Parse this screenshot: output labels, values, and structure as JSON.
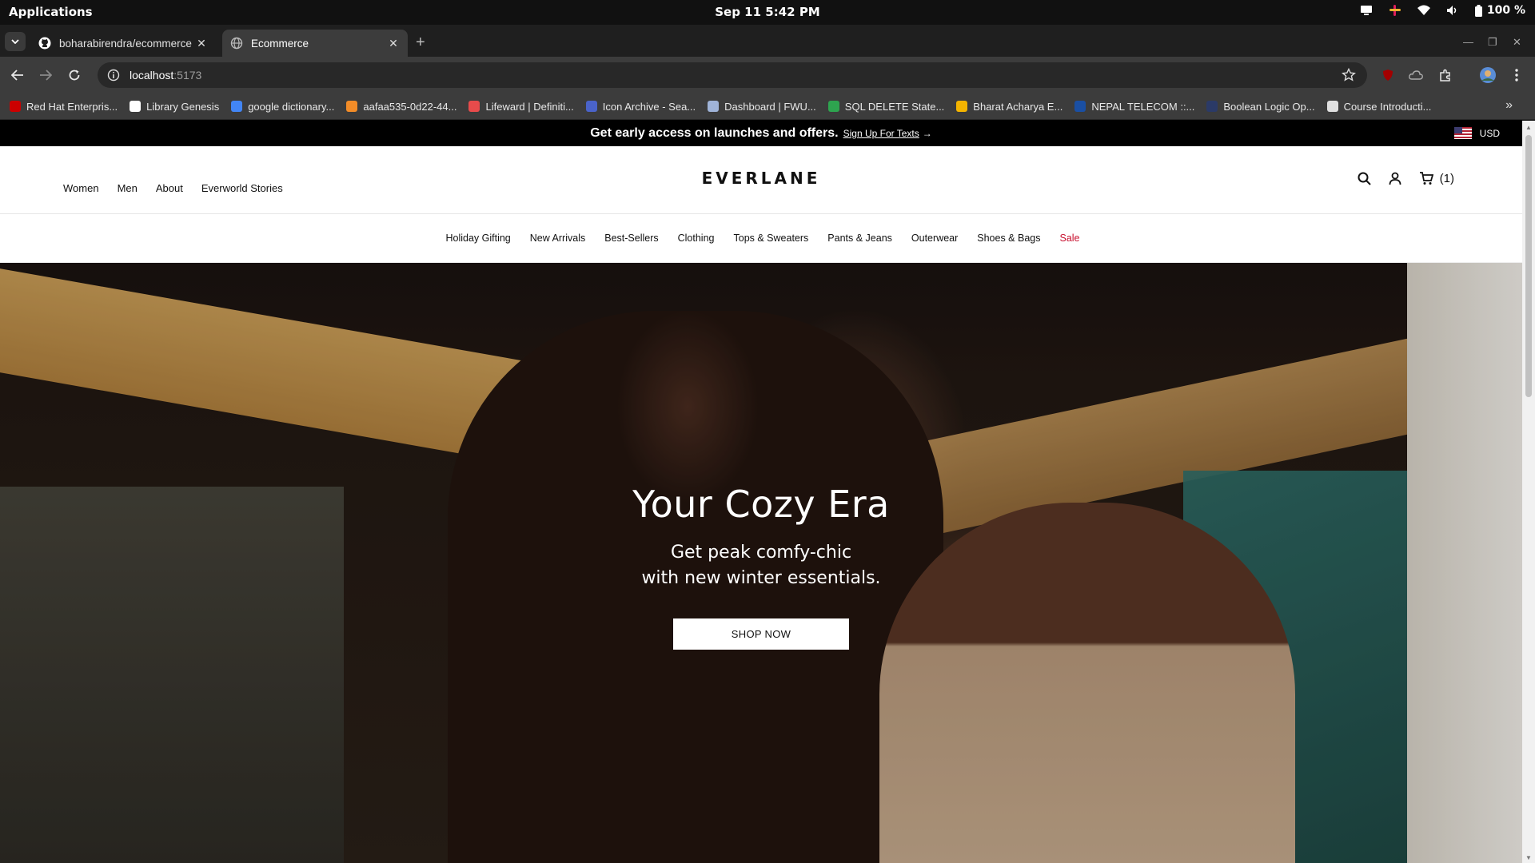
{
  "os": {
    "apps_label": "Applications",
    "clock": "Sep 11  5:42 PM",
    "battery": "100 %"
  },
  "browser": {
    "tabs": [
      {
        "title": "boharabirendra/ecommerce",
        "icon": "github-icon"
      },
      {
        "title": "Ecommerce",
        "icon": "globe-icon"
      }
    ],
    "url_host": "localhost",
    "url_port": ":5173",
    "bookmarks": [
      {
        "label": "Red Hat Enterpris...",
        "color": "#cc0000"
      },
      {
        "label": "Library Genesis",
        "color": "#ffffff"
      },
      {
        "label": "google dictionary...",
        "color": "#4285f4"
      },
      {
        "label": "aafaa535-0d22-44...",
        "color": "#f28c28"
      },
      {
        "label": "Lifeward | Definiti...",
        "color": "#e84b4b"
      },
      {
        "label": "Icon Archive - Sea...",
        "color": "#4a63c9"
      },
      {
        "label": "Dashboard | FWU...",
        "color": "#9fb3d8"
      },
      {
        "label": "SQL DELETE State...",
        "color": "#2ea44f"
      },
      {
        "label": "Bharat Acharya E...",
        "color": "#f4b400"
      },
      {
        "label": "NEPAL TELECOM ::...",
        "color": "#1a4fa3"
      },
      {
        "label": "Boolean Logic Op...",
        "color": "#2b3a67"
      },
      {
        "label": "Course Introducti...",
        "color": "#e0e0e0"
      }
    ],
    "bookmarks_more": "»"
  },
  "page": {
    "promo": {
      "text": "Get early access on launches and offers.",
      "link": "Sign Up For Texts",
      "arrow": "→",
      "currency": "USD"
    },
    "header": {
      "nav": [
        "Women",
        "Men",
        "About",
        "Everworld Stories"
      ],
      "logo": "EVERLANE",
      "cart_count": "(1)"
    },
    "categories": [
      "Holiday Gifting",
      "New Arrivals",
      "Best-Sellers",
      "Clothing",
      "Tops & Sweaters",
      "Pants & Jeans",
      "Outerwear",
      "Shoes & Bags"
    ],
    "sale_label": "Sale",
    "hero": {
      "title": "Your Cozy Era",
      "subtitle_line1": "Get peak comfy-chic",
      "subtitle_line2": "with new winter essentials.",
      "cta": "SHOP NOW"
    },
    "colors": {
      "sale": "#c8102e",
      "promo_bg": "#000000"
    }
  }
}
